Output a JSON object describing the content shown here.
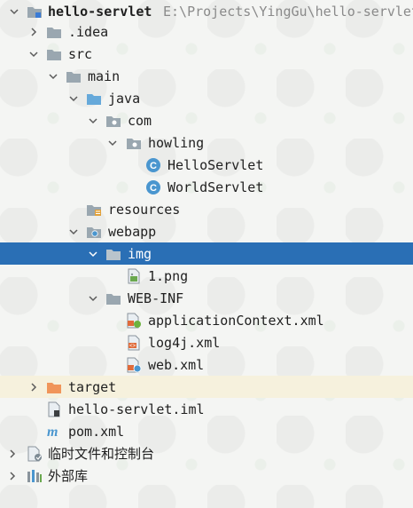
{
  "tree": {
    "root": {
      "name": "hello-servlet",
      "path": "E:\\Projects\\YingGu\\hello-servlet"
    },
    "idea": ".idea",
    "src": "src",
    "main": "main",
    "java": "java",
    "com": "com",
    "howling": "howling",
    "hello_servlet": "HelloServlet",
    "world_servlet": "WorldServlet",
    "resources": "resources",
    "webapp": "webapp",
    "img": "img",
    "png": "1.png",
    "webinf": "WEB-INF",
    "app_context": "applicationContext.xml",
    "log4j": "log4j.xml",
    "webxml": "web.xml",
    "target": "target",
    "iml": "hello-servlet.iml",
    "pom": "pom.xml",
    "scratches": "临时文件和控制台",
    "external_libs": "外部库"
  },
  "colors": {
    "selection": "#2a6fb5",
    "folder": "#9aa7b0",
    "source_folder": "#66a9da",
    "excluded_folder": "#f0955a",
    "class_icon": "#4a96cf"
  }
}
